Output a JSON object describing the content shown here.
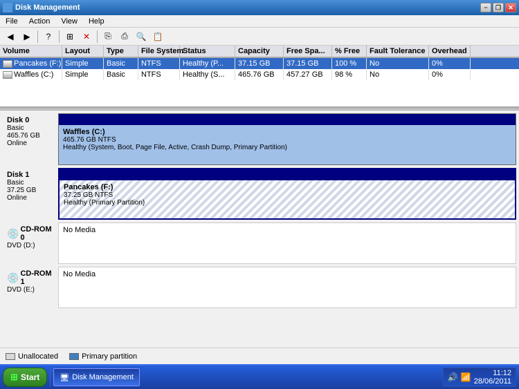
{
  "titleBar": {
    "title": "Disk Management",
    "buttons": {
      "minimize": "−",
      "restore": "❐",
      "close": "✕"
    }
  },
  "menuBar": {
    "items": [
      "File",
      "Action",
      "View",
      "Help"
    ]
  },
  "toolbar": {
    "buttons": [
      "◀",
      "▶",
      "?",
      "⊞",
      "✕",
      "⎘",
      "⎙",
      "🔍",
      "📋"
    ]
  },
  "columns": {
    "headers": [
      "Volume",
      "Layout",
      "Type",
      "File System",
      "Status",
      "Capacity",
      "Free Spa...",
      "% Free",
      "Fault Tolerance",
      "Overhead"
    ]
  },
  "volumes": [
    {
      "name": "Pancakes (F:)",
      "layout": "Simple",
      "type": "Basic",
      "fs": "NTFS",
      "status": "Healthy (P...",
      "capacity": "37.15 GB",
      "free": "37.15 GB",
      "pctFree": "100 %",
      "fault": "No",
      "overhead": "0%",
      "selected": true
    },
    {
      "name": "Waffles (C:)",
      "layout": "Simple",
      "type": "Basic",
      "fs": "NTFS",
      "status": "Healthy (S...",
      "capacity": "465.76 GB",
      "free": "457.27 GB",
      "pctFree": "98 %",
      "fault": "No",
      "overhead": "0%",
      "selected": false
    }
  ],
  "disks": [
    {
      "id": "Disk 0",
      "type": "Basic",
      "size": "465.76 GB",
      "status": "Online",
      "partitions": [
        {
          "name": "Waffles (C:)",
          "size": "465.76 GB NTFS",
          "health": "Healthy (System, Boot, Page File, Active, Crash Dump, Primary Partition)",
          "style": "primary"
        }
      ]
    },
    {
      "id": "Disk 1",
      "type": "Basic",
      "size": "37.25 GB",
      "status": "Online",
      "partitions": [
        {
          "name": "Pancakes (F:)",
          "size": "37.25 GB NTFS",
          "health": "Healthy (Primary Partition)",
          "style": "striped"
        }
      ]
    }
  ],
  "cdroms": [
    {
      "id": "CD-ROM 0",
      "type": "DVD (D:)",
      "noMedia": "No Media"
    },
    {
      "id": "CD-ROM 1",
      "type": "DVD (E:)",
      "noMedia": "No Media"
    }
  ],
  "legend": {
    "items": [
      "Unallocated",
      "Primary partition"
    ]
  },
  "taskbar": {
    "startLabel": "Start",
    "apps": [
      "Disk Management"
    ],
    "clock": {
      "time": "11:12",
      "date": "28/06/2011"
    }
  }
}
